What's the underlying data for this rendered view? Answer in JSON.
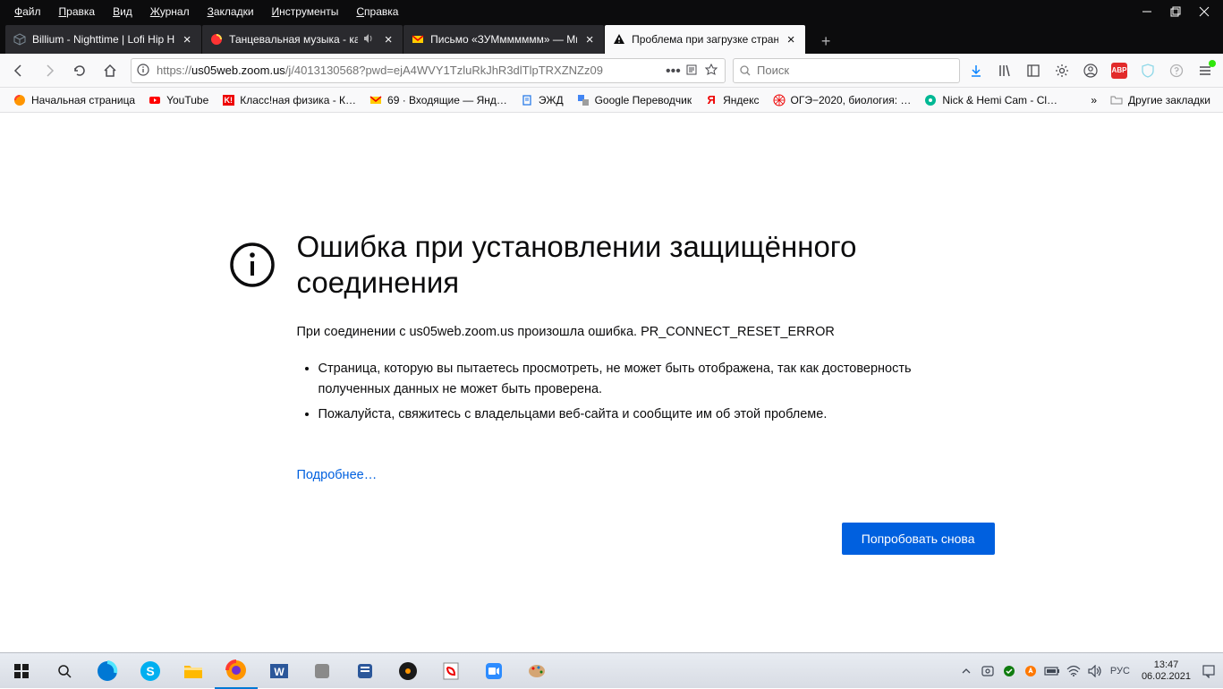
{
  "menubar": {
    "items": [
      {
        "label": "Файл",
        "ul": "Ф"
      },
      {
        "label": "Правка",
        "ul": "П"
      },
      {
        "label": "Вид",
        "ul": "В"
      },
      {
        "label": "Журнал",
        "ul": "Ж"
      },
      {
        "label": "Закладки",
        "ul": "З"
      },
      {
        "label": "Инструменты",
        "ul": "И"
      },
      {
        "label": "Справка",
        "ul": "С"
      }
    ]
  },
  "tabs": {
    "items": [
      {
        "title": "Billium - Nighttime | Lofi Hip H",
        "icon": "cube",
        "sound": false
      },
      {
        "title": "Танцевальная музыка - кан",
        "icon": "yandex-music",
        "sound": true
      },
      {
        "title": "Письмо «ЗУМмммммм» — Ми",
        "icon": "mail",
        "sound": false
      },
      {
        "title": "Проблема при загрузке стран",
        "icon": "warning",
        "sound": false
      }
    ],
    "activeIndex": 3
  },
  "navbar": {
    "url_proto": "https://",
    "url_host": "us05web.zoom.us",
    "url_path": "/j/4013130568?pwd=ejA4WVY1TzluRkJhR3dlTlpTRXZNZz09",
    "search_placeholder": "Поиск"
  },
  "bookmarks": {
    "items": [
      {
        "label": "Начальная страница",
        "icon": "firefox"
      },
      {
        "label": "YouTube",
        "icon": "youtube"
      },
      {
        "label": "Класс!ная физика - К…",
        "icon": "kf"
      },
      {
        "label": "69 · Входящие — Янд…",
        "icon": "mail"
      },
      {
        "label": "ЭЖД",
        "icon": "doc"
      },
      {
        "label": "Google Переводчик",
        "icon": "gtranslate"
      },
      {
        "label": "Яндекс",
        "icon": "yandex"
      },
      {
        "label": "ОГЭ−2020, биология: …",
        "icon": "oge"
      },
      {
        "label": "Nick & Hemi Cam - Cl…",
        "icon": "cam"
      }
    ],
    "other_label": "Другие закладки"
  },
  "error": {
    "title": "Ошибка при установлении защищённого соединения",
    "desc": "При соединении с us05web.zoom.us произошла ошибка. PR_CONNECT_RESET_ERROR",
    "bullet1": "Страница, которую вы пытаетесь просмотреть, не может быть отображена, так как достоверность полученных данных не может быть проверена.",
    "bullet2": "Пожалуйста, свяжитесь с владельцами веб-сайта и сообщите им об этой проблеме.",
    "more_link": "Подробнее…",
    "try_again": "Попробовать снова"
  },
  "taskbar": {
    "lang": "РУС",
    "time": "13:47",
    "date": "06.02.2021"
  },
  "abp_label": "ABP"
}
